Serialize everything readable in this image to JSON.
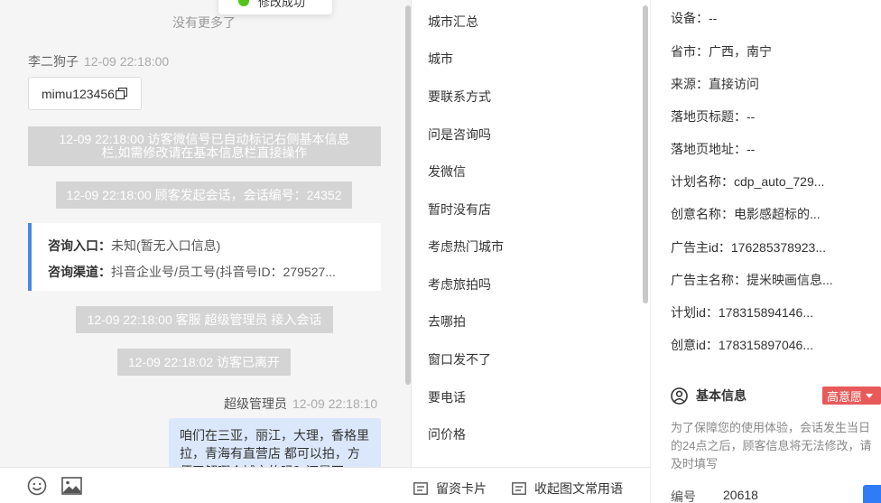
{
  "toast": {
    "text": "修改成功"
  },
  "chat": {
    "no_more": "没有更多了",
    "visitor_name": "李二狗子",
    "visitor_time": "12-09 22:18:00",
    "wechat_id": "mimu123456",
    "system_messages": [
      "12-09 22:18:00 访客微信号已自动标记右侧基本信息栏,如需修改请在基本信息栏直接操作",
      "12-09 22:18:00 顾客发起会话，会话编号：24352",
      "12-09 22:18:00 客服 超级管理员 接入会话",
      "12-09 22:18:02 访客已离开"
    ],
    "info_card": {
      "entry_label": "咨询入口：",
      "entry_value": "未知(暂无入口信息)",
      "channel_label": "咨询渠道：",
      "channel_value": "抖音企业号/员工号(抖音号ID：279527..."
    },
    "agent_name": "超级管理员",
    "agent_time": "12-09 22:18:10",
    "agent_message": "咱们在三亚，丽江，大理，香格里拉，青海有直营店 都可以拍，方便了解哪个城市的吗？还是不"
  },
  "quick_replies": {
    "items": [
      "城市汇总",
      "城市",
      "要联系方式",
      "问是咨询吗",
      "发微信",
      "暂时没有店",
      "考虑热门城市",
      "考虑旅拍吗",
      "去哪拍",
      "窗口发不了",
      "要电话",
      "问价格"
    ],
    "card_button": "留资卡片",
    "collapse_button": "收起图文常用语"
  },
  "visitor_info": {
    "rows": [
      "设备：--",
      "省市：广西，南宁",
      "来源：直接访问",
      "落地页标题：--",
      "落地页地址：--",
      "计划名称：cdp_auto_729...",
      "创意名称：电影感超标的...",
      "广告主id：176285378923...",
      "广告主名称：提米映画信息...",
      "计划id：178315894146...",
      "创意id：178315897046..."
    ],
    "section_title": "基本信息",
    "intent_badge": "高意愿",
    "notice": "为了保障您的使用体验，会话发生当日的24点之后，顾客信息将无法修改，请及时填写",
    "number_label": "编号",
    "number_value": "20618"
  },
  "colors": {
    "accent": "#4a86e8",
    "system_message_bg": "#d4d4d4",
    "badge": "#e85a5a",
    "agent_bubble": "#dbe8fb"
  }
}
